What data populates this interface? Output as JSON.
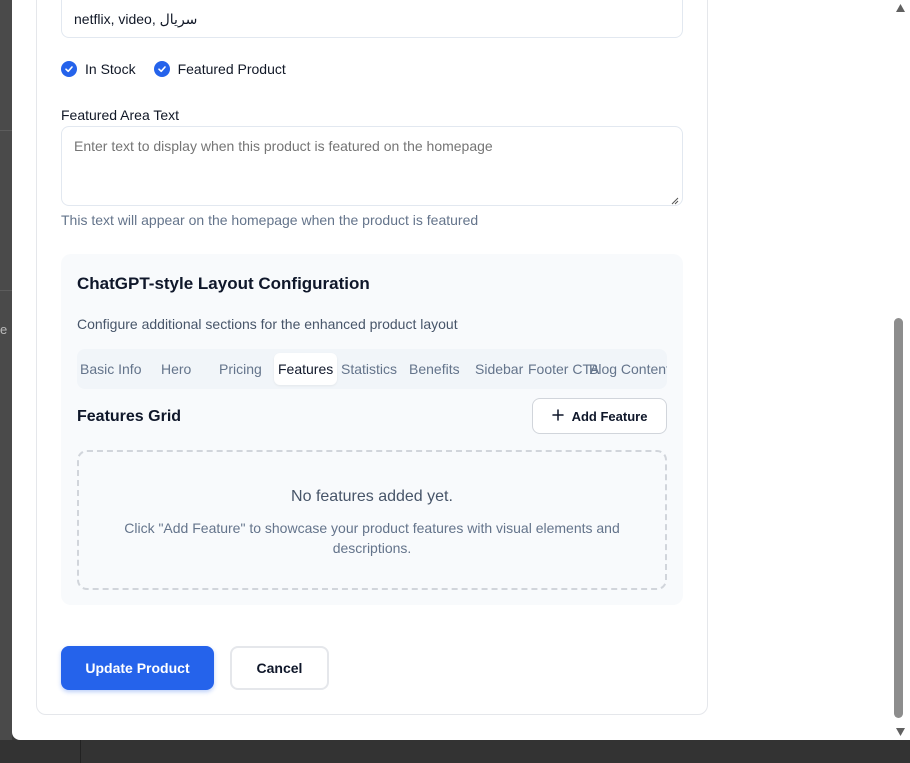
{
  "form": {
    "tags_value": "netflix, video, سريال",
    "checkboxes": [
      {
        "label": "In Stock",
        "checked": true
      },
      {
        "label": "Featured Product",
        "checked": true
      }
    ],
    "featured_text_label": "Featured Area Text",
    "featured_text_placeholder": "Enter text to display when this product is featured on the homepage",
    "featured_text_help": "This text will appear on the homepage when the product is featured"
  },
  "layout_config": {
    "title": "ChatGPT-style Layout Configuration",
    "description": "Configure additional sections for the enhanced product layout",
    "tabs": [
      {
        "label": "Basic Info",
        "active": false
      },
      {
        "label": "Hero",
        "active": false
      },
      {
        "label": "Pricing",
        "active": false
      },
      {
        "label": "Features",
        "active": true
      },
      {
        "label": "Statistics",
        "active": false
      },
      {
        "label": "Benefits",
        "active": false
      },
      {
        "label": "Sidebar",
        "active": false
      },
      {
        "label": "Footer CTA",
        "active": false
      },
      {
        "label": "Blog Content",
        "active": false
      }
    ],
    "features": {
      "title": "Features Grid",
      "add_button_label": "Add Feature",
      "empty_title": "No features added yet.",
      "empty_description": "Click \"Add Feature\" to showcase your product features with visual elements and descriptions."
    }
  },
  "actions": {
    "update_label": "Update Product",
    "cancel_label": "Cancel"
  },
  "colors": {
    "accent": "#2563eb",
    "panel_bg": "#f8fafc"
  },
  "icons": {
    "check": "check-icon",
    "plus": "plus-icon",
    "resize": "resize-grip-icon",
    "scroll_up": "arrow-up-icon",
    "scroll_down": "arrow-down-icon"
  }
}
